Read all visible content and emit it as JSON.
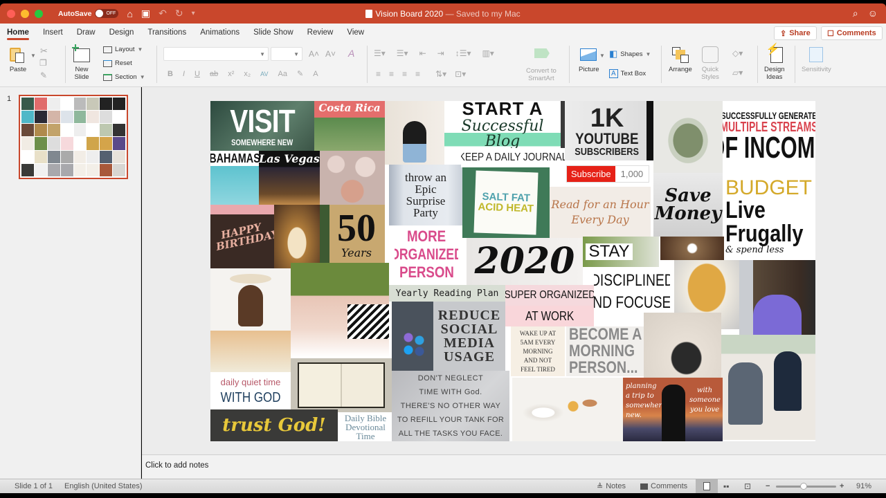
{
  "window": {
    "title": "Vision Board 2020",
    "subtitle": "— Saved to my Mac",
    "autosave_label": "AutoSave",
    "autosave_state": "OFF"
  },
  "icons": {
    "home": "⌂",
    "save": "▣",
    "undo": "↶",
    "redo": "↻",
    "customize": "▾",
    "search": "⌕",
    "account": "☺",
    "share": "⇪",
    "comment": "☐"
  },
  "tabs": [
    {
      "label": "Home",
      "active": true
    },
    {
      "label": "Insert"
    },
    {
      "label": "Draw"
    },
    {
      "label": "Design"
    },
    {
      "label": "Transitions"
    },
    {
      "label": "Animations"
    },
    {
      "label": "Slide Show"
    },
    {
      "label": "Review"
    },
    {
      "label": "View"
    }
  ],
  "header_buttons": {
    "share": "Share",
    "comments": "Comments"
  },
  "ribbon": {
    "paste": "Paste",
    "new_slide_1": "New",
    "new_slide_2": "Slide",
    "layout": "Layout",
    "reset": "Reset",
    "section": "Section",
    "font_name": "",
    "font_size": "",
    "format_buttons": [
      "B",
      "I",
      "U",
      "ab",
      "x²",
      "x₂",
      "AV",
      "Aa",
      "✎",
      "A"
    ],
    "convert_smartart_1": "Convert to",
    "convert_smartart_2": "SmartArt",
    "picture": "Picture",
    "shapes": "Shapes",
    "text_box": "Text Box",
    "arrange": "Arrange",
    "quick_styles_1": "Quick",
    "quick_styles_2": "Styles",
    "design_ideas_1": "Design",
    "design_ideas_2": "Ideas",
    "sensitivity": "Sensitivity"
  },
  "slides_pane": {
    "slide_number": "1"
  },
  "slide": {
    "tiles": {
      "visit_top": "VISIT",
      "visit_sub": "SOMEWHERE NEW",
      "costa_rica": "Costa Rica",
      "start_a": "START A",
      "successful_blog": "Successful Blog",
      "keep_journal": "KEEP A DAILY JOURNAL",
      "yt_1k": "1K",
      "yt_youtube": "YOUTUBE",
      "yt_subscribers": "SUBSCRIBERS",
      "yt_subscribe_btn": "Subscribe",
      "yt_count": "1,000",
      "income_1": "SUCCESSFULLY GENERATE",
      "income_2": "MULTIPLE STREAMS",
      "income_3": "OF INCOME",
      "bahamas": "BAHAMAS",
      "las_vegas": "Las Vegas",
      "party_1": "throw an",
      "party_2": "Epic",
      "party_3": "Surprise",
      "party_4": "Party",
      "book_1": "SALT FAT",
      "book_2": "ACID HEAT",
      "read_1": "Read for an Hour",
      "read_2": "Every Day",
      "save_1": "Save",
      "save_2": "Money",
      "budget": "BUDGET",
      "live_1": "Live",
      "live_2": "Frugally",
      "live_3": "& spend less",
      "happy_birthday": "HAPPY BIRTHDAY",
      "fifty": "50",
      "fifty_years": "Years",
      "organized_1": "MORE",
      "organized_2": "ORGANIZED",
      "organized_3": "PERSON",
      "year_2020": "2020",
      "stay": "STAY",
      "disciplined": "DISCIPLINED",
      "focused": "AND FOCUSED",
      "reading_plan": "Yearly Reading Plan",
      "super_organized": "SUPER ORGANIZED",
      "at_work": "AT WORK",
      "reduce_1": "REDUCE",
      "reduce_2": "SOCIAL",
      "reduce_3": "MEDIA",
      "reduce_4": "USAGE",
      "wake_1": "WAKE UP AT",
      "wake_2": "5AM EVERY",
      "wake_3": "MORNING",
      "wake_4": "AND NOT",
      "wake_5": "FEEL TIRED",
      "morning_1": "BECOME A",
      "morning_2": "MORNING",
      "morning_3": "PERSON...",
      "quiet_1": "daily quiet time",
      "quiet_2": "WITH GOD",
      "trust_god": "trust God!",
      "bible_1": "Daily Bible",
      "bible_2": "Devotional",
      "bible_3": "Time",
      "neglect_1": "DON'T NEGLECT",
      "neglect_2": "TIME WITH God.",
      "neglect_3": "THERE'S NO OTHER WAY",
      "neglect_4": "TO REFILL YOUR TANK FOR",
      "neglect_5": "ALL THE TASKS YOU FACE.",
      "trip_1": "planning a trip to somewhere new.",
      "trip_2": "with someone you love"
    }
  },
  "notes": {
    "placeholder": "Click to add notes"
  },
  "status": {
    "slide_info": "Slide 1 of 1",
    "language": "English (United States)",
    "notes": "Notes",
    "comments": "Comments",
    "zoom_minus": "−",
    "zoom_plus": "+",
    "zoom_percent": "91%",
    "zoom_level": 0.91
  }
}
